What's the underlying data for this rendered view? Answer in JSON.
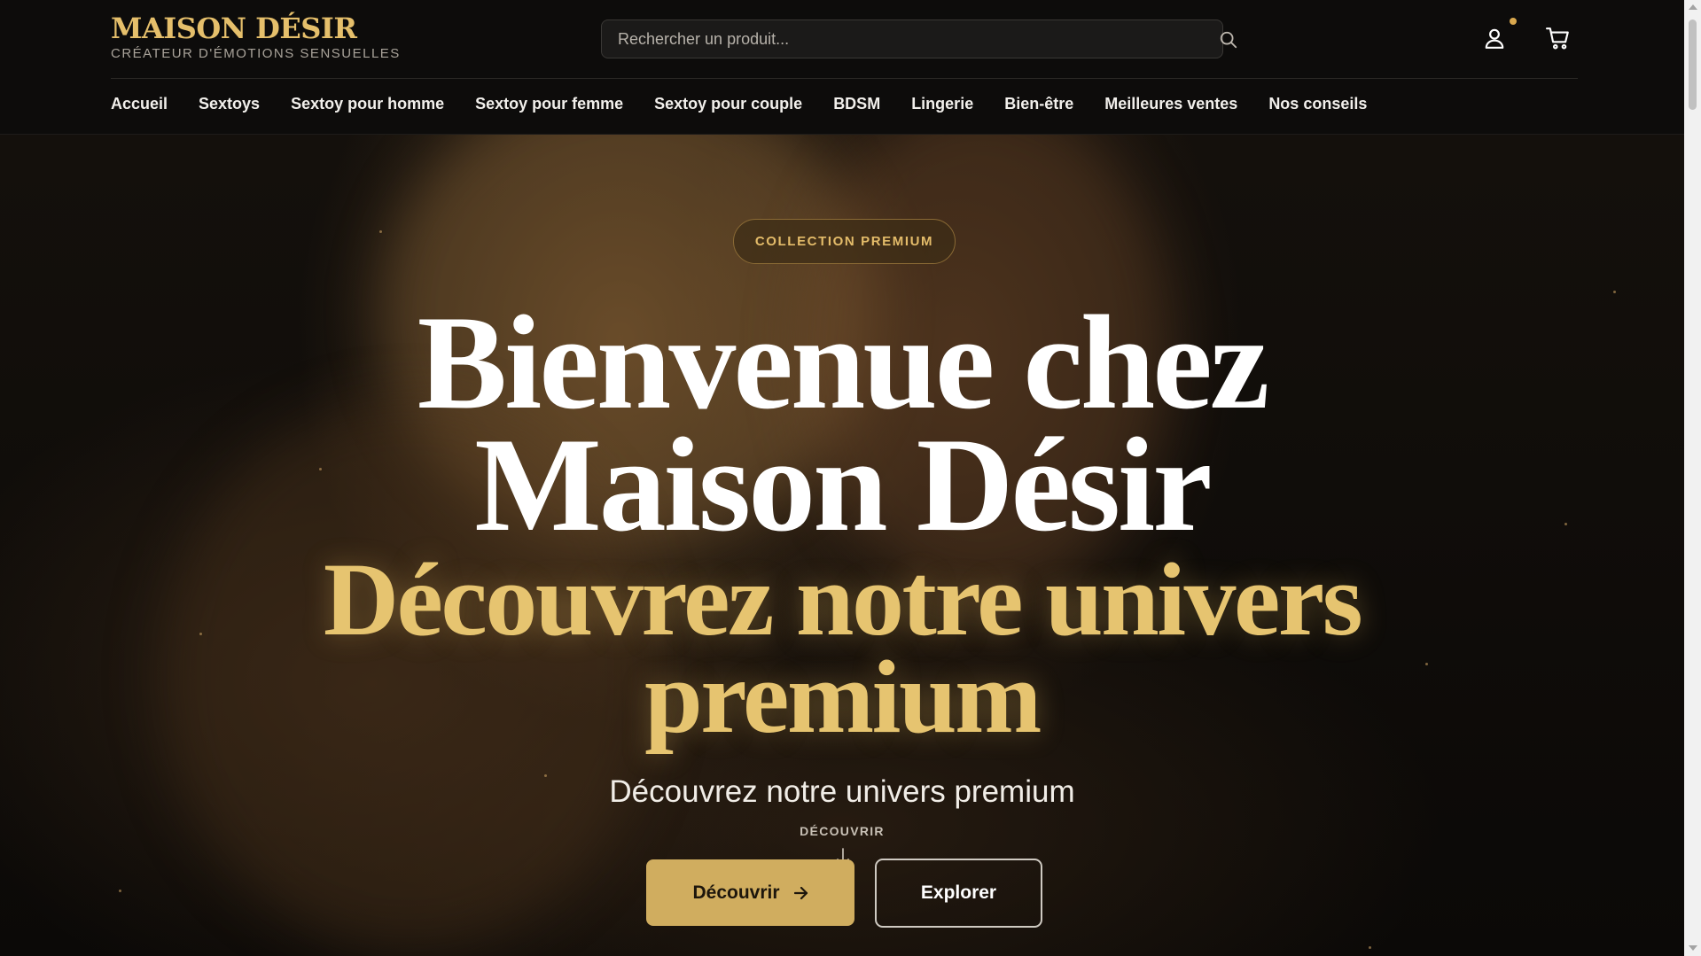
{
  "brand": {
    "name": "MAISON DÉSIR",
    "tagline": "CRÉATEUR D'ÉMOTIONS SENSUELLES",
    "accent_color": "#e5bf6b"
  },
  "search": {
    "placeholder": "Rechercher un produit...",
    "value": "",
    "icon": "search-icon"
  },
  "header_icons": {
    "account": "user-icon",
    "cart": "cart-icon"
  },
  "nav": {
    "items": [
      {
        "label": "Accueil"
      },
      {
        "label": "Sextoys"
      },
      {
        "label": "Sextoy pour homme"
      },
      {
        "label": "Sextoy pour femme"
      },
      {
        "label": "Sextoy pour couple"
      },
      {
        "label": "BDSM"
      },
      {
        "label": "Lingerie"
      },
      {
        "label": "Bien-être"
      },
      {
        "label": "Meilleures ventes"
      },
      {
        "label": "Nos conseils"
      }
    ]
  },
  "hero": {
    "badge": "COLLECTION PREMIUM",
    "title_line1": "Bienvenue chez",
    "title_line2": "Maison Désir",
    "subtitle_line1": "Découvrez notre univers",
    "subtitle_line2": "premium",
    "tagline": "Découvrez notre univers premium",
    "scroll_label": "DÉCOUVRIR",
    "primary_button": "Découvrir",
    "secondary_button": "Explorer",
    "primary_color": "#d0ad5f"
  }
}
